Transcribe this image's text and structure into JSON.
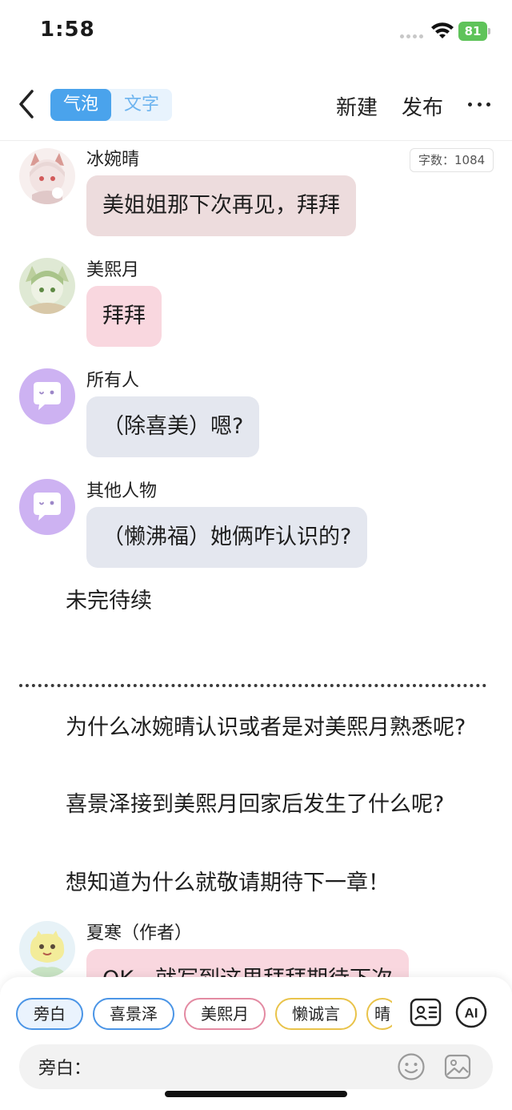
{
  "status": {
    "time": "1:58",
    "battery": "81"
  },
  "header": {
    "tabs": [
      {
        "label": "气泡",
        "active": true
      },
      {
        "label": "文字",
        "active": false
      }
    ],
    "new_label": "新建",
    "publish_label": "发布"
  },
  "word_count": "字数：1084",
  "messages": [
    {
      "name": "冰婉晴",
      "text": "美姐姐那下次再见，拜拜",
      "bubble_color": "#eddcdd"
    },
    {
      "name": "美熙月",
      "text": "拜拜",
      "bubble_color": "#f9d7df"
    },
    {
      "name": "所有人",
      "text": "（除喜美）嗯?",
      "bubble_color": "#e4e7ef"
    },
    {
      "name": "其他人物",
      "text": "（懒沸福）她俩咋认识的?",
      "bubble_color": "#e4e7ef"
    }
  ],
  "narration": {
    "tbc": "未完待续",
    "q1": "为什么冰婉晴认识或者是对美熙月熟悉呢?",
    "q2": "喜景泽接到美熙月回家后发生了什么呢?",
    "q3": "想知道为什么就敬请期待下一章！"
  },
  "author_message": {
    "name": "夏寒（作者）",
    "text": "OK，就写到这里拜拜期待下次"
  },
  "bottom": {
    "chips": [
      {
        "label": "旁白",
        "color": "#4b95e6"
      },
      {
        "label": "喜景泽",
        "color": "#4b95e6"
      },
      {
        "label": "美熙月",
        "color": "#e38aa2"
      },
      {
        "label": "懒诚言",
        "color": "#e9c34a"
      },
      {
        "label": "晴",
        "color": "#e9c34a"
      }
    ],
    "input_label": "旁白："
  },
  "colors": {
    "accent": "#4aa3ec",
    "avatar_purple": "#cdb2f2"
  },
  "icons": [
    "back-chevron-icon",
    "more-icon",
    "chat-bubble-icon",
    "contacts-icon",
    "ai-icon",
    "emoji-icon",
    "image-icon",
    "wifi-icon"
  ]
}
